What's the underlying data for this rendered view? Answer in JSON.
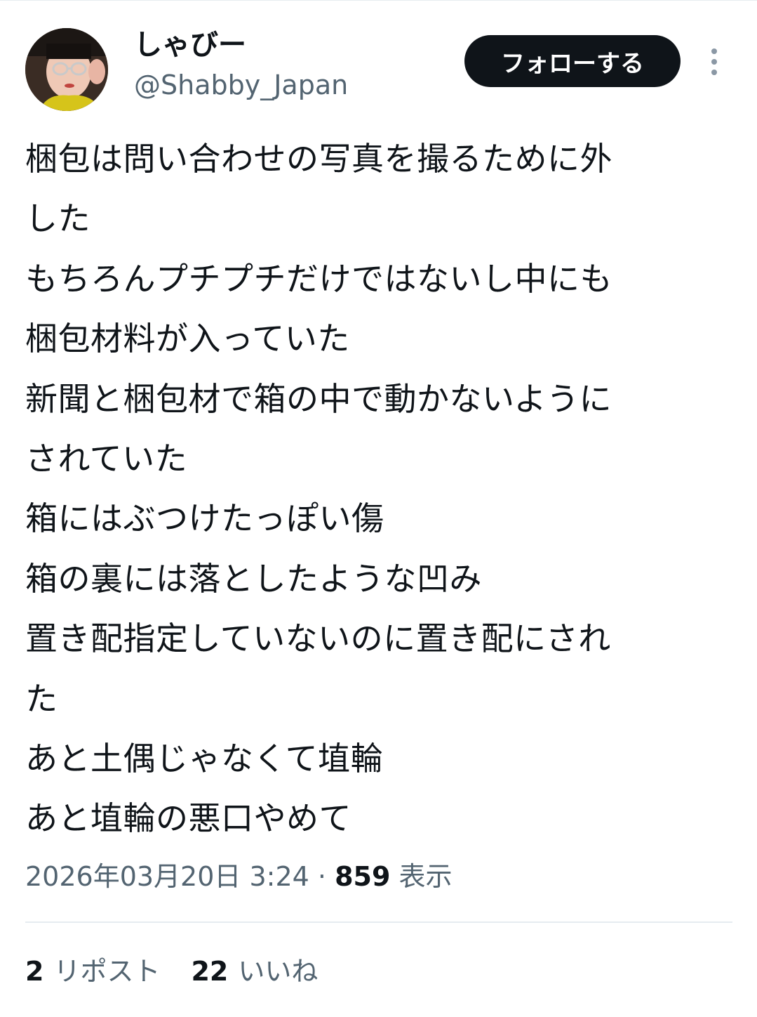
{
  "author": {
    "display_name": "しゃびー",
    "handle": "@Shabby_Japan",
    "avatar_icon": "user-avatar-icon"
  },
  "actions": {
    "follow_label": "フォローする",
    "more_icon": "more-vertical-icon"
  },
  "tweet": {
    "lines": [
      "梱包は問い合わせの写真を撮るために外",
      "した",
      "もちろんプチプチだけではないし中にも",
      "梱包材料が入っていた",
      "新聞と梱包材で箱の中で動かないように",
      "されていた",
      "箱にはぶつけたっぽい傷",
      "箱の裏には落としたような凹み",
      "置き配指定していないのに置き配にされ",
      "た",
      "あと土偶じゃなくて埴輪",
      "あと埴輪の悪口やめて"
    ]
  },
  "meta": {
    "timestamp": "2026年03月20日 3:24",
    "separator": " · ",
    "views_count": "859",
    "views_label": " 表示"
  },
  "stats": {
    "reposts_count": "2",
    "reposts_label": "リポスト",
    "likes_count": "22",
    "likes_label": "いいね"
  },
  "colors": {
    "text_primary": "#0f1419",
    "text_secondary": "#536471",
    "divider": "#e6ecf0",
    "follow_bg": "#0f1419"
  }
}
